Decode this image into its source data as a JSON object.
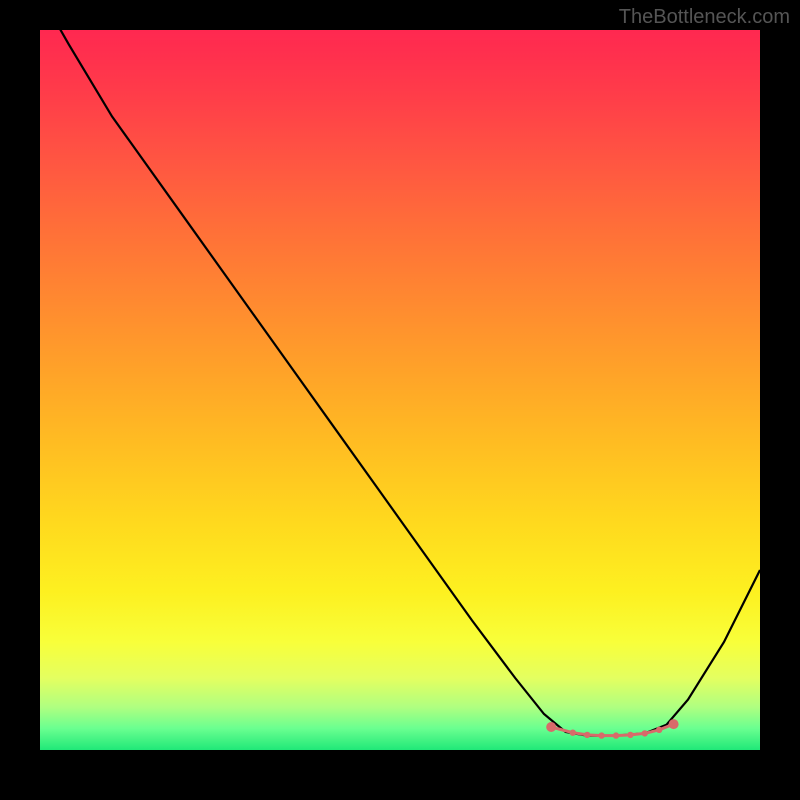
{
  "watermark": "TheBottleneck.com",
  "chart_data": {
    "type": "line",
    "title": "",
    "xlabel": "",
    "ylabel": "",
    "xlim": [
      0,
      100
    ],
    "ylim": [
      0,
      100
    ],
    "description": "Bottleneck curve: V-shaped line over vertical heat gradient (red=high bottleneck at top, green=optimal at bottom). Minimum plateau around x=72-86 indicates best match region.",
    "series": [
      {
        "name": "bottleneck-curve",
        "x": [
          0,
          4,
          10,
          20,
          30,
          40,
          50,
          60,
          66,
          70,
          73,
          76,
          80,
          84,
          87,
          90,
          95,
          100
        ],
        "y": [
          105,
          98,
          88,
          74,
          60,
          46,
          32,
          18,
          10,
          5,
          2.5,
          2,
          2,
          2.3,
          3.5,
          7,
          15,
          25
        ]
      },
      {
        "name": "optimal-markers",
        "type": "scatter",
        "x": [
          71,
          74,
          76,
          78,
          80,
          82,
          84,
          86,
          88
        ],
        "y": [
          3.2,
          2.4,
          2.1,
          2.0,
          2.0,
          2.1,
          2.3,
          2.8,
          3.6
        ]
      }
    ],
    "colors": {
      "curve": "#000000",
      "markers": "#d86a6a",
      "gradient_top": "#ff2850",
      "gradient_bottom": "#20e878"
    }
  }
}
